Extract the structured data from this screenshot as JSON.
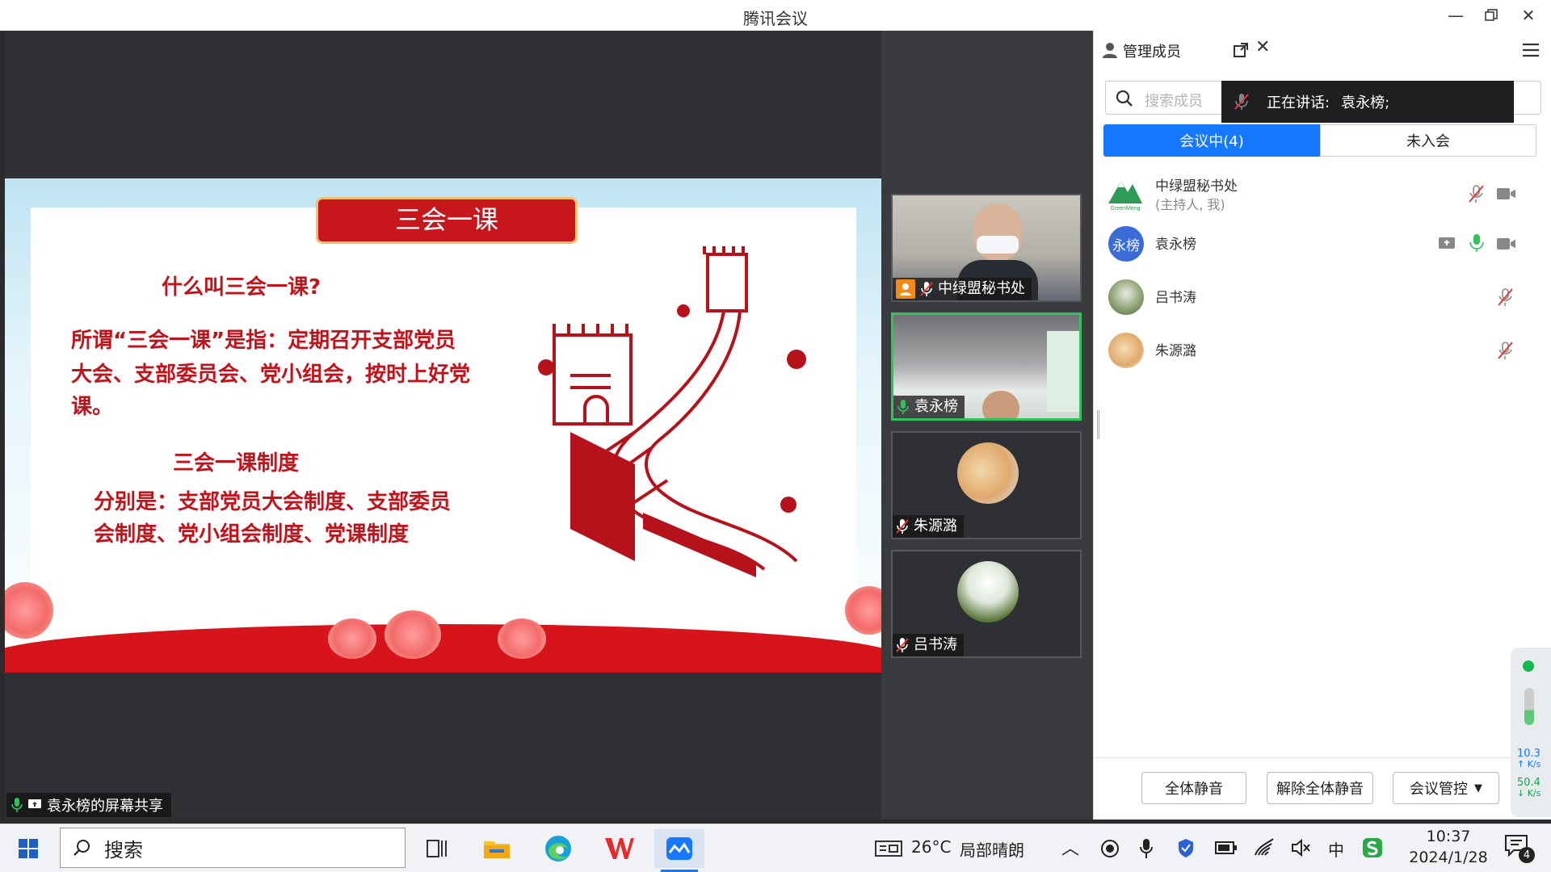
{
  "window": {
    "title": "腾讯会议"
  },
  "share_label": "袁永榜的屏幕共享",
  "slide": {
    "banner": "三会一课",
    "q1": "什么叫三会一课?",
    "p1_line1": "所谓“三会一课”是指：定期召开支部党员",
    "p1_line2": "大会、支部委员会、党小组会，按时上好党",
    "p1_line3": "课。",
    "h2": "三会一课制度",
    "p2_line1": "分别是：支部党员大会制度、支部委员",
    "p2_line2": "会制度、党小组会制度、党课制度"
  },
  "tiles": [
    {
      "name": "中绿盟秘书处",
      "muted": true,
      "host": true
    },
    {
      "name": "袁永榜",
      "muted": false,
      "speaking": true
    },
    {
      "name": "朱源潞",
      "muted": true
    },
    {
      "name": "吕书涛",
      "muted": true
    }
  ],
  "panel": {
    "title": "管理成员",
    "search_placeholder": "搜索成员",
    "speaking_label": "正在讲话:",
    "speaking_name": "袁永榜;",
    "tab_in": "会议中(4)",
    "tab_out": "未入会",
    "members": [
      {
        "name": "中绿盟秘书处",
        "sub": "(主持人, 我)"
      },
      {
        "name": "袁永榜",
        "avatar_text": "永榜"
      },
      {
        "name": "吕书涛"
      },
      {
        "name": "朱源潞"
      }
    ],
    "btn_mute_all": "全体静音",
    "btn_unmute_all": "解除全体静音",
    "btn_control": "会议管控",
    "net_up": "10.3",
    "net_up_unit": "K/s",
    "net_down": "50.4",
    "net_down_unit": "K/s"
  },
  "taskbar": {
    "search": "搜索",
    "weather_temp": "26°C",
    "weather_desc": "局部晴朗",
    "ime": "中",
    "time": "10:37",
    "date": "2024/1/28",
    "notif_count": "4"
  },
  "colors": {
    "accent": "#1677ff",
    "slide_red": "#c0141c",
    "green": "#2ec45a"
  }
}
